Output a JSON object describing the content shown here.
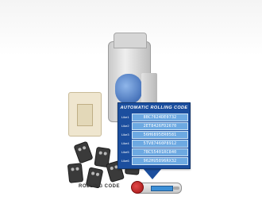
{
  "callout": {
    "title": "AUTOMATIC ROLLING CODE",
    "codes": [
      {
        "label": "Like1",
        "value": "8BC7624DE0732"
      },
      {
        "label": "Like2",
        "value": "2ET8426FD2670"
      },
      {
        "label": "Like3",
        "value": "56H6895ER0581"
      },
      {
        "label": "Like4",
        "value": "5TV87460P8912"
      },
      {
        "label": "Like5",
        "value": "7BC55401RC840"
      },
      {
        "label": "Like6",
        "value": "962HU5896RX32"
      }
    ]
  },
  "footer": {
    "label": "ROLLING CODE"
  },
  "colors": {
    "callout_bg": "#1b4e9e",
    "code_field": "#6da9e2",
    "background": "#ffffff"
  },
  "icons": {
    "product": "roller-shutter-motor-kit",
    "fob": "key-fob-remote"
  }
}
